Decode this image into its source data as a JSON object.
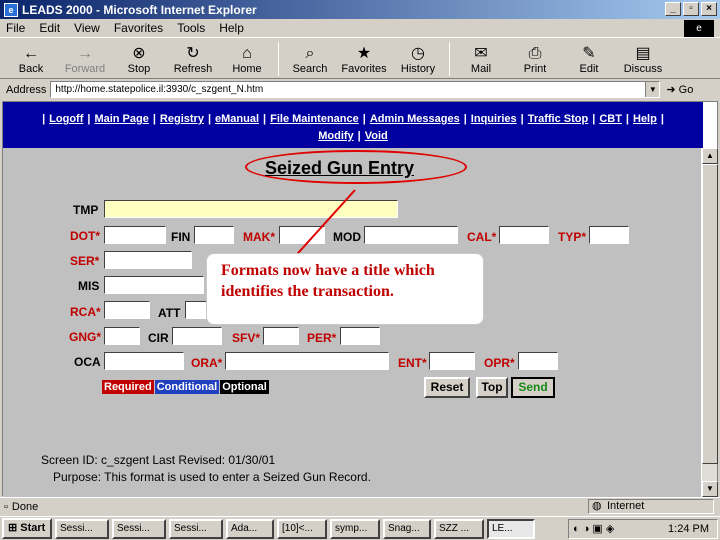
{
  "window": {
    "title": "LEADS 2000 - Microsoft Internet Explorer",
    "controls": [
      "_",
      "▫",
      "×"
    ]
  },
  "menu": [
    "File",
    "Edit",
    "View",
    "Favorites",
    "Tools",
    "Help"
  ],
  "toolbar": [
    {
      "label": "Back",
      "icon": "←",
      "name": "back"
    },
    {
      "label": "Forward",
      "icon": "→",
      "name": "forward",
      "disabled": true
    },
    {
      "label": "Stop",
      "icon": "⊗",
      "name": "stop"
    },
    {
      "label": "Refresh",
      "icon": "↻",
      "name": "refresh"
    },
    {
      "label": "Home",
      "icon": "⌂",
      "name": "home"
    },
    {
      "label": "Search",
      "icon": "⌕",
      "name": "search"
    },
    {
      "label": "Favorites",
      "icon": "★",
      "name": "favorites"
    },
    {
      "label": "History",
      "icon": "◷",
      "name": "history"
    },
    {
      "label": "Mail",
      "icon": "✉",
      "name": "mail"
    },
    {
      "label": "Print",
      "icon": "⎙",
      "name": "print"
    },
    {
      "label": "Edit",
      "icon": "✎",
      "name": "edit"
    },
    {
      "label": "Discuss",
      "icon": "▤",
      "name": "discuss"
    }
  ],
  "address": {
    "label": "Address",
    "url": "http://home.statepolice.il:3930/c_szgent_N.htm",
    "go": "Go"
  },
  "nav": {
    "row1": [
      "Logoff",
      "Main Page",
      "Registry",
      "eManual",
      "File Maintenance",
      "Admin Messages",
      "Inquiries",
      "Traffic Stop",
      "CBT",
      "Help"
    ],
    "row2": [
      "Modify",
      "Void"
    ]
  },
  "form": {
    "title": "Seized Gun Entry",
    "fields": {
      "tmp": "TMP",
      "dot": "DOT*",
      "fin": "FIN",
      "mak": "MAK*",
      "mod": "MOD",
      "cal": "CAL*",
      "typ": "TYP*",
      "ser": "SER*",
      "mis": "MIS",
      "rca": "RCA*",
      "att": "ATT",
      "gng": "GNG*",
      "cir": "CIR",
      "sfv": "SFV*",
      "per": "PER*",
      "oca": "OCA",
      "ora": "ORA*",
      "ent": "ENT*",
      "opr": "OPR*"
    },
    "legend": {
      "required": "Required",
      "conditional": "Conditional",
      "optional": "Optional"
    },
    "buttons": {
      "reset": "Reset",
      "top": "Top",
      "send": "Send"
    },
    "screen_id": "Screen ID:  c_szgent    Last Revised: 01/30/01",
    "purpose": "Purpose: This format is used to enter a Seized Gun Record."
  },
  "callout": {
    "text": "Formats now have a title which identifies the transaction."
  },
  "status": {
    "left": "Done",
    "zone": "Internet"
  },
  "taskbar": {
    "start": "Start",
    "tasks": [
      "Sessi...",
      "Sessi...",
      "Sessi...",
      "Ada...",
      "[10]<...",
      "symp...",
      "Snag...",
      "SZZ ...",
      "LE..."
    ],
    "clock": "1:24 PM"
  },
  "colors": {
    "required": "#c00000",
    "conditional": "#2040c0",
    "optional": "#000000",
    "nav_band": "#0000a0",
    "callout_text": "#c00000"
  }
}
